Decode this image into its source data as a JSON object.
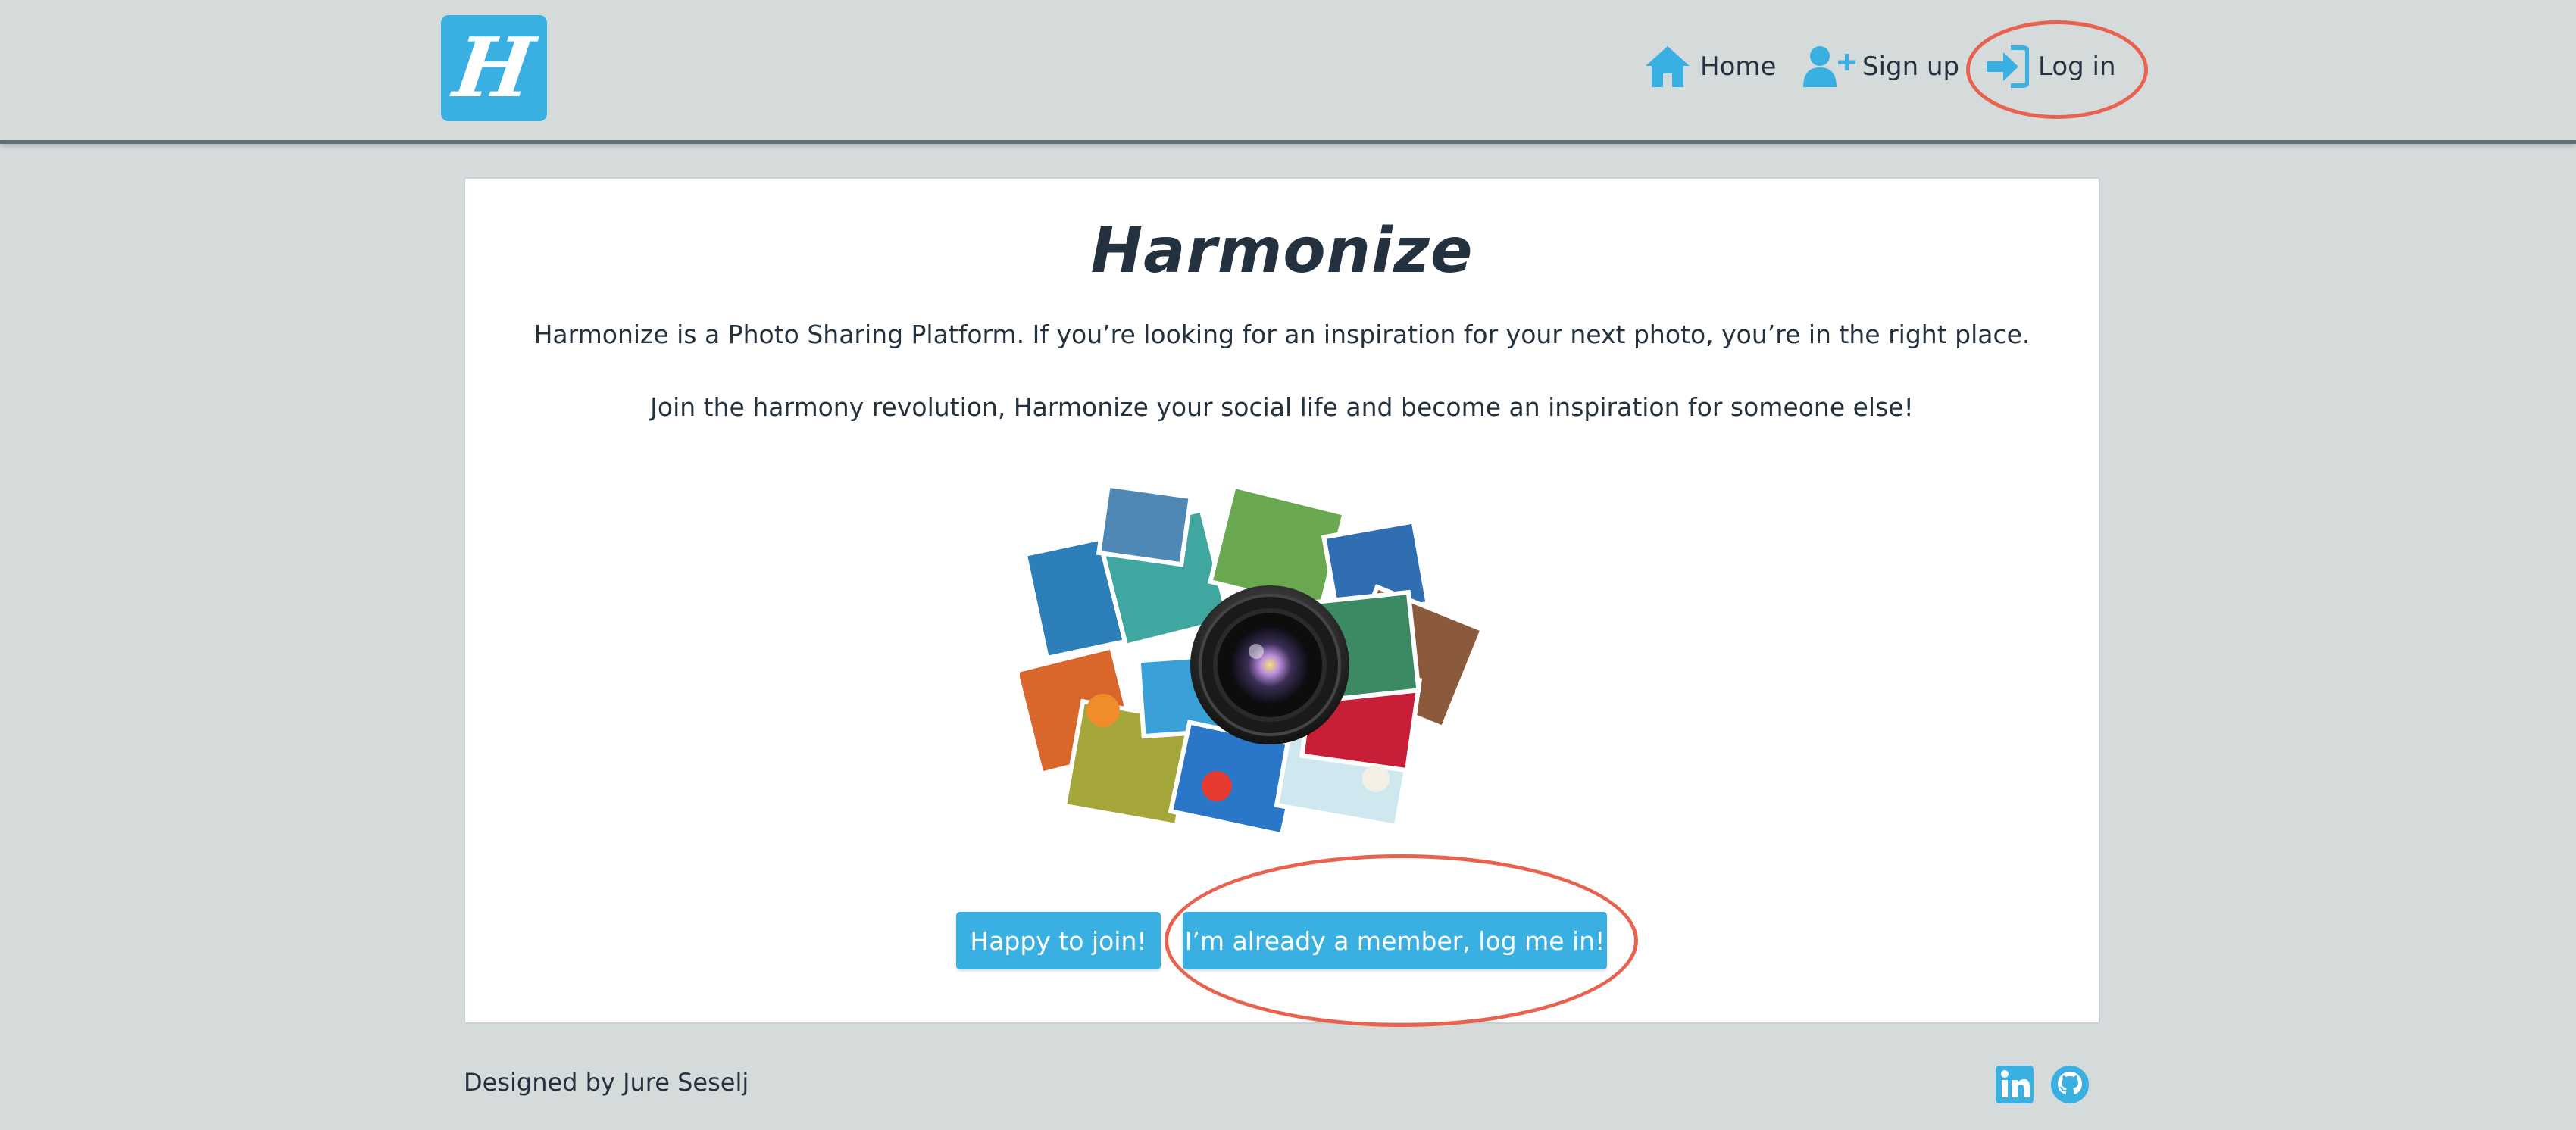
{
  "header": {
    "logo_letter": "H",
    "nav": {
      "home": "Home",
      "signup": "Sign up",
      "login": "Log in"
    }
  },
  "main": {
    "title": "Harmonize",
    "paragraph1": "Harmonize is a Photo Sharing Platform. If you’re looking for an inspiration for your next photo, you’re in the right place.",
    "paragraph2": "Join the harmony revolution, Harmonize your social life and become an inspiration for someone else!",
    "buttons": {
      "join": "Happy to join!",
      "member": "I’m already a member, log me in!"
    }
  },
  "footer": {
    "credit": "Designed by Jure Seselj",
    "icons": [
      "linkedin-icon",
      "github-icon"
    ]
  },
  "colors": {
    "accent": "#3ab0e2",
    "text": "#24323f",
    "background": "#d5dadb",
    "annotation": "#e8624f"
  }
}
